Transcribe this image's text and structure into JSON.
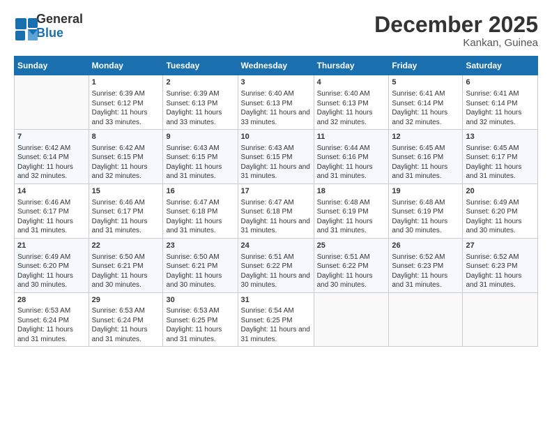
{
  "logo": {
    "line1": "General",
    "line2": "Blue"
  },
  "title": "December 2025",
  "subtitle": "Kankan, Guinea",
  "headers": [
    "Sunday",
    "Monday",
    "Tuesday",
    "Wednesday",
    "Thursday",
    "Friday",
    "Saturday"
  ],
  "weeks": [
    [
      {
        "day": "",
        "sunrise": "",
        "sunset": "",
        "daylight": ""
      },
      {
        "day": "1",
        "sunrise": "Sunrise: 6:39 AM",
        "sunset": "Sunset: 6:12 PM",
        "daylight": "Daylight: 11 hours and 33 minutes."
      },
      {
        "day": "2",
        "sunrise": "Sunrise: 6:39 AM",
        "sunset": "Sunset: 6:13 PM",
        "daylight": "Daylight: 11 hours and 33 minutes."
      },
      {
        "day": "3",
        "sunrise": "Sunrise: 6:40 AM",
        "sunset": "Sunset: 6:13 PM",
        "daylight": "Daylight: 11 hours and 33 minutes."
      },
      {
        "day": "4",
        "sunrise": "Sunrise: 6:40 AM",
        "sunset": "Sunset: 6:13 PM",
        "daylight": "Daylight: 11 hours and 32 minutes."
      },
      {
        "day": "5",
        "sunrise": "Sunrise: 6:41 AM",
        "sunset": "Sunset: 6:14 PM",
        "daylight": "Daylight: 11 hours and 32 minutes."
      },
      {
        "day": "6",
        "sunrise": "Sunrise: 6:41 AM",
        "sunset": "Sunset: 6:14 PM",
        "daylight": "Daylight: 11 hours and 32 minutes."
      }
    ],
    [
      {
        "day": "7",
        "sunrise": "Sunrise: 6:42 AM",
        "sunset": "Sunset: 6:14 PM",
        "daylight": "Daylight: 11 hours and 32 minutes."
      },
      {
        "day": "8",
        "sunrise": "Sunrise: 6:42 AM",
        "sunset": "Sunset: 6:15 PM",
        "daylight": "Daylight: 11 hours and 32 minutes."
      },
      {
        "day": "9",
        "sunrise": "Sunrise: 6:43 AM",
        "sunset": "Sunset: 6:15 PM",
        "daylight": "Daylight: 11 hours and 31 minutes."
      },
      {
        "day": "10",
        "sunrise": "Sunrise: 6:43 AM",
        "sunset": "Sunset: 6:15 PM",
        "daylight": "Daylight: 11 hours and 31 minutes."
      },
      {
        "day": "11",
        "sunrise": "Sunrise: 6:44 AM",
        "sunset": "Sunset: 6:16 PM",
        "daylight": "Daylight: 11 hours and 31 minutes."
      },
      {
        "day": "12",
        "sunrise": "Sunrise: 6:45 AM",
        "sunset": "Sunset: 6:16 PM",
        "daylight": "Daylight: 11 hours and 31 minutes."
      },
      {
        "day": "13",
        "sunrise": "Sunrise: 6:45 AM",
        "sunset": "Sunset: 6:17 PM",
        "daylight": "Daylight: 11 hours and 31 minutes."
      }
    ],
    [
      {
        "day": "14",
        "sunrise": "Sunrise: 6:46 AM",
        "sunset": "Sunset: 6:17 PM",
        "daylight": "Daylight: 11 hours and 31 minutes."
      },
      {
        "day": "15",
        "sunrise": "Sunrise: 6:46 AM",
        "sunset": "Sunset: 6:17 PM",
        "daylight": "Daylight: 11 hours and 31 minutes."
      },
      {
        "day": "16",
        "sunrise": "Sunrise: 6:47 AM",
        "sunset": "Sunset: 6:18 PM",
        "daylight": "Daylight: 11 hours and 31 minutes."
      },
      {
        "day": "17",
        "sunrise": "Sunrise: 6:47 AM",
        "sunset": "Sunset: 6:18 PM",
        "daylight": "Daylight: 11 hours and 31 minutes."
      },
      {
        "day": "18",
        "sunrise": "Sunrise: 6:48 AM",
        "sunset": "Sunset: 6:19 PM",
        "daylight": "Daylight: 11 hours and 31 minutes."
      },
      {
        "day": "19",
        "sunrise": "Sunrise: 6:48 AM",
        "sunset": "Sunset: 6:19 PM",
        "daylight": "Daylight: 11 hours and 30 minutes."
      },
      {
        "day": "20",
        "sunrise": "Sunrise: 6:49 AM",
        "sunset": "Sunset: 6:20 PM",
        "daylight": "Daylight: 11 hours and 30 minutes."
      }
    ],
    [
      {
        "day": "21",
        "sunrise": "Sunrise: 6:49 AM",
        "sunset": "Sunset: 6:20 PM",
        "daylight": "Daylight: 11 hours and 30 minutes."
      },
      {
        "day": "22",
        "sunrise": "Sunrise: 6:50 AM",
        "sunset": "Sunset: 6:21 PM",
        "daylight": "Daylight: 11 hours and 30 minutes."
      },
      {
        "day": "23",
        "sunrise": "Sunrise: 6:50 AM",
        "sunset": "Sunset: 6:21 PM",
        "daylight": "Daylight: 11 hours and 30 minutes."
      },
      {
        "day": "24",
        "sunrise": "Sunrise: 6:51 AM",
        "sunset": "Sunset: 6:22 PM",
        "daylight": "Daylight: 11 hours and 30 minutes."
      },
      {
        "day": "25",
        "sunrise": "Sunrise: 6:51 AM",
        "sunset": "Sunset: 6:22 PM",
        "daylight": "Daylight: 11 hours and 30 minutes."
      },
      {
        "day": "26",
        "sunrise": "Sunrise: 6:52 AM",
        "sunset": "Sunset: 6:23 PM",
        "daylight": "Daylight: 11 hours and 31 minutes."
      },
      {
        "day": "27",
        "sunrise": "Sunrise: 6:52 AM",
        "sunset": "Sunset: 6:23 PM",
        "daylight": "Daylight: 11 hours and 31 minutes."
      }
    ],
    [
      {
        "day": "28",
        "sunrise": "Sunrise: 6:53 AM",
        "sunset": "Sunset: 6:24 PM",
        "daylight": "Daylight: 11 hours and 31 minutes."
      },
      {
        "day": "29",
        "sunrise": "Sunrise: 6:53 AM",
        "sunset": "Sunset: 6:24 PM",
        "daylight": "Daylight: 11 hours and 31 minutes."
      },
      {
        "day": "30",
        "sunrise": "Sunrise: 6:53 AM",
        "sunset": "Sunset: 6:25 PM",
        "daylight": "Daylight: 11 hours and 31 minutes."
      },
      {
        "day": "31",
        "sunrise": "Sunrise: 6:54 AM",
        "sunset": "Sunset: 6:25 PM",
        "daylight": "Daylight: 11 hours and 31 minutes."
      },
      {
        "day": "",
        "sunrise": "",
        "sunset": "",
        "daylight": ""
      },
      {
        "day": "",
        "sunrise": "",
        "sunset": "",
        "daylight": ""
      },
      {
        "day": "",
        "sunrise": "",
        "sunset": "",
        "daylight": ""
      }
    ]
  ]
}
